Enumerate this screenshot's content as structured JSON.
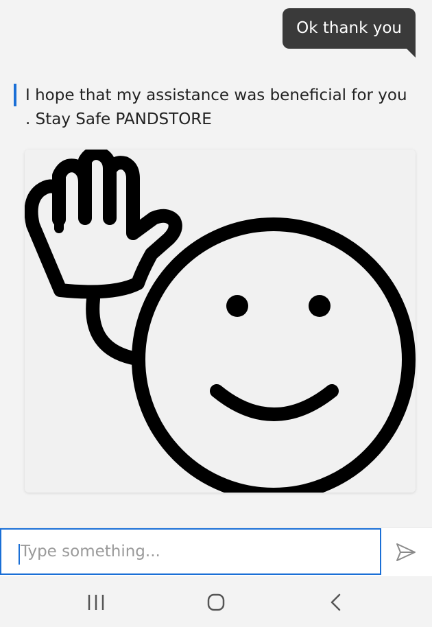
{
  "chat": {
    "user_message": "Ok thank you",
    "bot_message": "I hope that my assistance was beneficial for you . Stay Safe PANDSTORE",
    "image": {
      "icon": "waving-smiley-icon"
    }
  },
  "composer": {
    "placeholder": "Type something...",
    "value": "",
    "send_icon": "send-icon"
  },
  "navigation": {
    "recents_icon": "recents-icon",
    "home_icon": "home-icon",
    "back_icon": "back-icon"
  },
  "colors": {
    "accent": "#1a6fd6",
    "user_bubble": "#3a3a3a",
    "background": "#f3f3f3"
  }
}
